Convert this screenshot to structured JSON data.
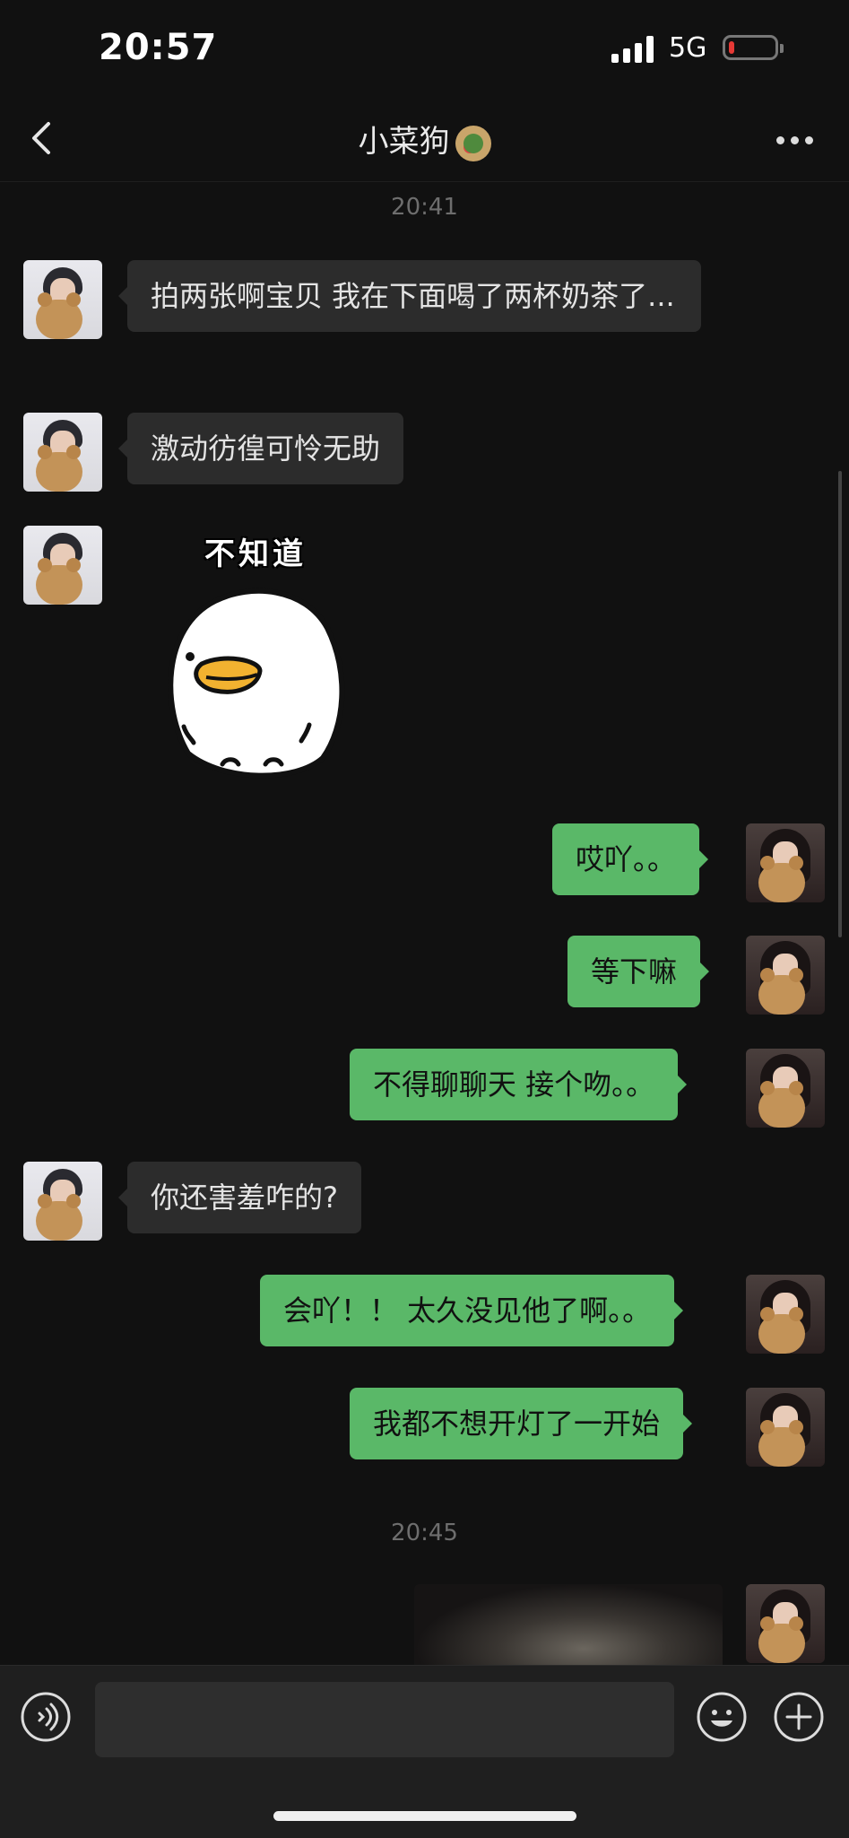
{
  "status_bar": {
    "time": "20:57",
    "network": "5G",
    "battery_level": 0.12
  },
  "nav": {
    "title": "小菜狗",
    "title_emoji": "food-plate-emoji"
  },
  "timestamps": [
    "20:41",
    "20:45"
  ],
  "messages": [
    {
      "side": "in",
      "text": "拍两张啊宝贝 我在下面喝了两杯奶茶了..."
    },
    {
      "side": "in",
      "text": "激动彷徨可怜无助"
    },
    {
      "side": "in",
      "type": "sticker",
      "caption": "不知道",
      "sticker": "white-duck-sticker"
    },
    {
      "side": "out",
      "text": "哎吖。。"
    },
    {
      "side": "out",
      "text": "等下嘛"
    },
    {
      "side": "out",
      "text": "不得聊聊天 接个吻。。"
    },
    {
      "side": "in",
      "text": "你还害羞咋的?"
    },
    {
      "side": "out",
      "text": "会吖！！ 太久没见他了啊。。"
    },
    {
      "side": "out",
      "text": "我都不想开灯了一开始"
    },
    {
      "side": "out",
      "type": "image"
    }
  ],
  "input_bar": {
    "text_value": "",
    "icons": [
      "voice-icon",
      "emoji-icon",
      "plus-icon"
    ]
  },
  "colors": {
    "background": "#111111",
    "bubble_in": "#2c2c2c",
    "bubble_out": "#5ab868",
    "input_bar": "#1f1f1f"
  }
}
